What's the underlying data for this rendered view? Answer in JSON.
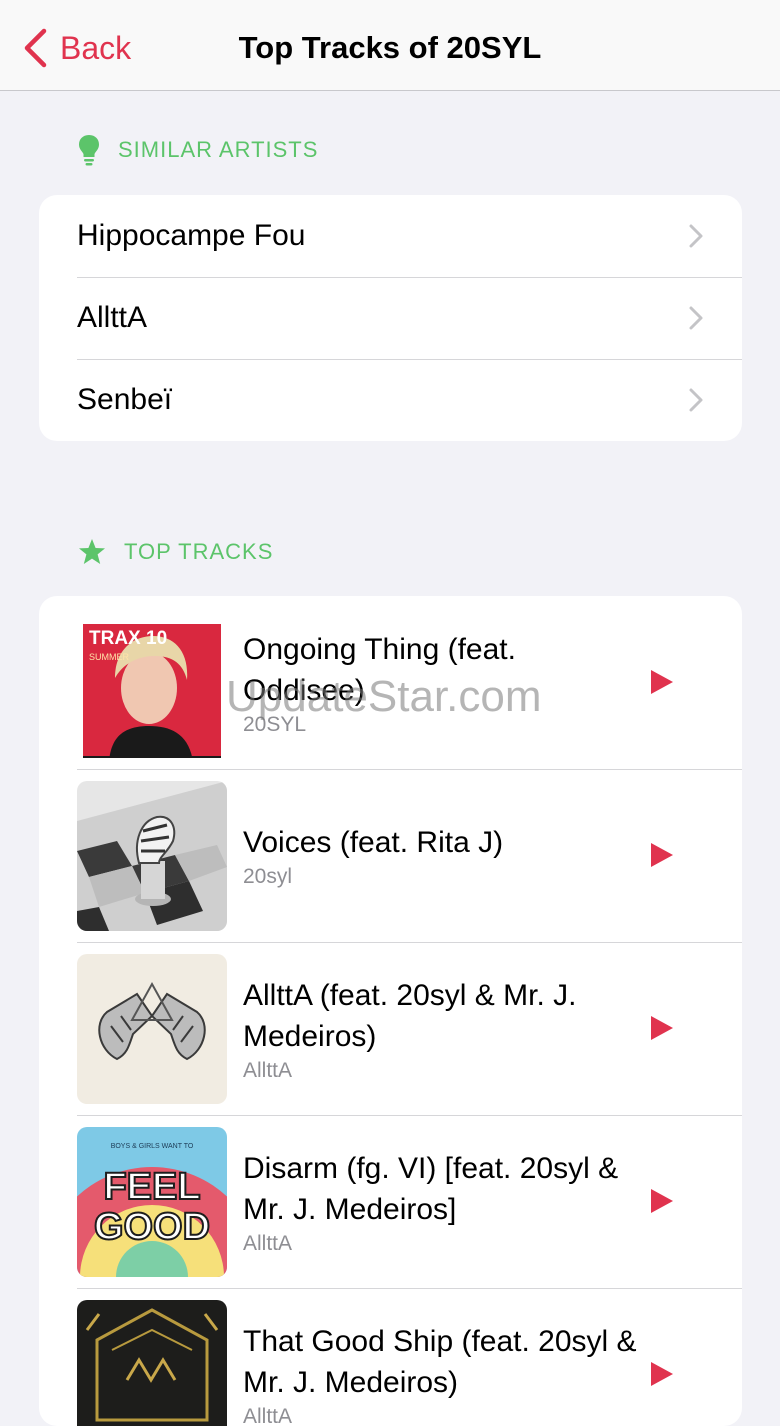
{
  "nav": {
    "back_label": "Back",
    "title": "Top Tracks of 20SYL"
  },
  "similar_artists": {
    "header": "SIMILAR ARTISTS",
    "icon": "lightbulb-icon",
    "items": [
      {
        "label": "Hippocampe Fou"
      },
      {
        "label": "AllttA"
      },
      {
        "label": "Senbeï"
      }
    ]
  },
  "top_tracks": {
    "header": "TOP TRACKS",
    "icon": "star-icon",
    "items": [
      {
        "title": "Ongoing Thing (feat. Oddisee)",
        "artist": "20SYL",
        "art_text": "TRAX 10",
        "art_subtext": "SUMMER"
      },
      {
        "title": "Voices (feat. Rita J)",
        "artist": "20syl"
      },
      {
        "title": "AllttA (feat. 20syl & Mr. J. Medeiros)",
        "artist": "AllttA"
      },
      {
        "title": "Disarm (fg. VI) [feat. 20syl & Mr. J. Medeiros]",
        "artist": "AllttA",
        "art_text_top": "BOYS & GIRLS WANT TO",
        "art_text_1": "FEEL",
        "art_text_2": "GOOD"
      },
      {
        "title": "That Good Ship (feat. 20syl & Mr. J. Medeiros)",
        "artist": "AllttA"
      }
    ]
  },
  "watermark": "UpdateStar.com",
  "colors": {
    "accent_red": "#e0334e",
    "section_green": "#5cc46a",
    "background": "#f2f2f7"
  }
}
